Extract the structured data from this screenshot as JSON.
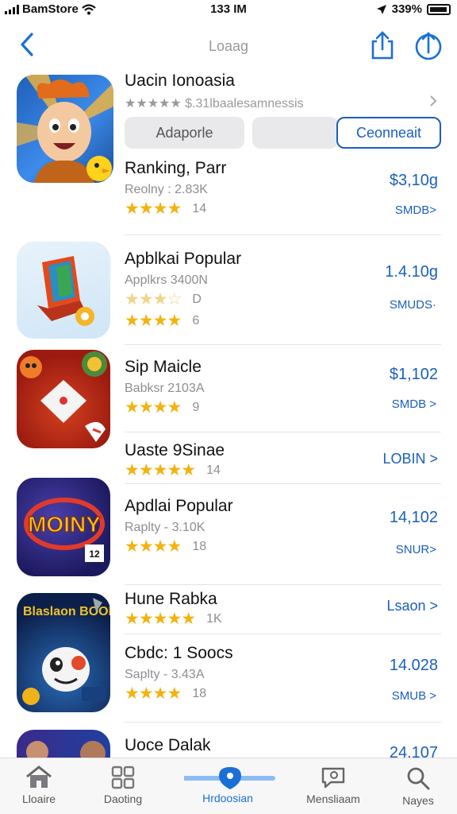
{
  "status_bar": {
    "carrier": "BamStore",
    "time": "133 IM",
    "battery": "339%"
  },
  "nav": {
    "title": "Loaag"
  },
  "header_app": {
    "name": "Uacin Ionoasia",
    "rating_line": "★★★★★ $.31lbaalesamnessis",
    "segments": [
      "Adaporle",
      "",
      "Ceonneait"
    ]
  },
  "list": [
    {
      "name": "Ranking, Parr",
      "sub": "Reolny : 2.83K",
      "stars": "★★★★",
      "count": "14",
      "price": "$3,10g",
      "more": "SMDB>"
    },
    {
      "name": "Apblkai Popular",
      "sub": "Applkrs 3400N",
      "stars_pale": "★★★☆",
      "count_pale": "D",
      "stars": "★★★★",
      "count": "6",
      "price": "1.4.10g",
      "more": "SMUDS·"
    },
    {
      "name": "Sip Maicle",
      "sub": "Babksr 2103A",
      "stars": "★★★★",
      "count": "9",
      "price": "$1,102",
      "more": "SMDB >"
    },
    {
      "name": "Uaste 9Sinae",
      "stars": "★★★★★",
      "count": "14",
      "link": "LOBIN >"
    },
    {
      "name": "Apdlai Popular",
      "sub": "Raplty - 3.10K",
      "stars": "★★★★",
      "count": "18",
      "price": "14,102",
      "more": "SNUR>"
    },
    {
      "name": "Hune Rabka",
      "stars": "★★★★★",
      "count": "1K",
      "link": "Lsaon >"
    },
    {
      "name": "Cbdc: 1 Soocs",
      "sub": "Saplty - 3.43A",
      "stars": "★★★★",
      "count": "18",
      "price": "14.028",
      "more": "SMUB >"
    },
    {
      "name": "Uoce Dalak",
      "price": "24.107"
    }
  ],
  "icon_texts": {
    "movie": "MOINY",
    "movie_badge": "12",
    "space_title": "Blaslaon BOOIAD"
  },
  "tabs": [
    {
      "label": "Lloaire",
      "icon": "home-icon"
    },
    {
      "label": "Daoting",
      "icon": "grid-icon"
    },
    {
      "label": "Hrdoosian",
      "icon": "location-pin-icon"
    },
    {
      "label": "Mensliaam",
      "icon": "chat-icon"
    },
    {
      "label": "Nayes",
      "icon": "search-icon"
    }
  ],
  "colors": {
    "accent": "#1a6fd6",
    "star": "#f2b311"
  }
}
